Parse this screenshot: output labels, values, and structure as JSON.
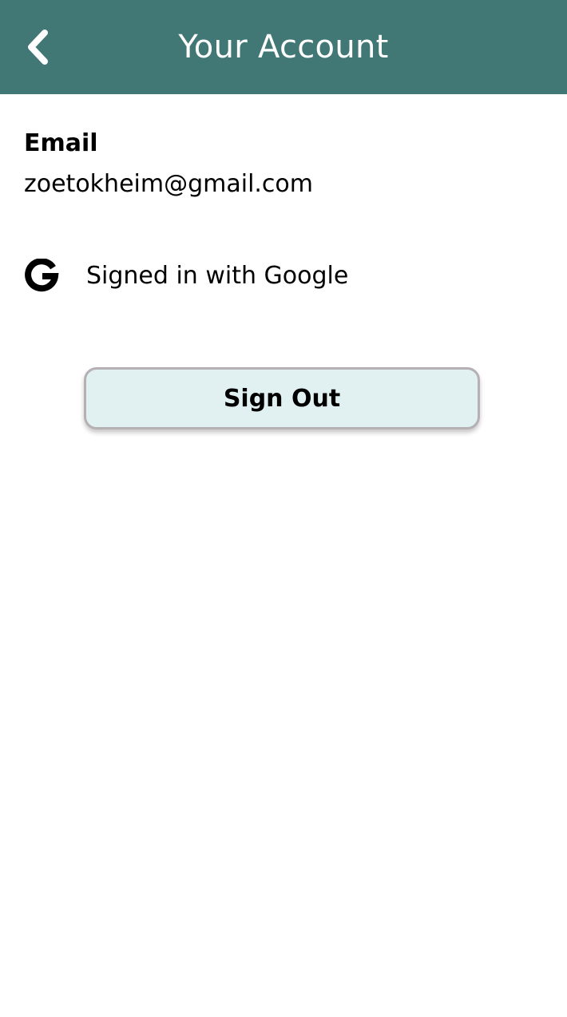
{
  "header": {
    "title": "Your Account",
    "background_color": "#417875",
    "back_icon": "chevron-left-icon"
  },
  "account": {
    "email_label": "Email",
    "email_value": "zoetokheim@gmail.com",
    "provider_icon": "google-icon",
    "provider_text": "Signed in with Google"
  },
  "actions": {
    "sign_out_label": "Sign Out",
    "button_background": "#e1f1f1",
    "button_border": "#b5b0b3"
  }
}
